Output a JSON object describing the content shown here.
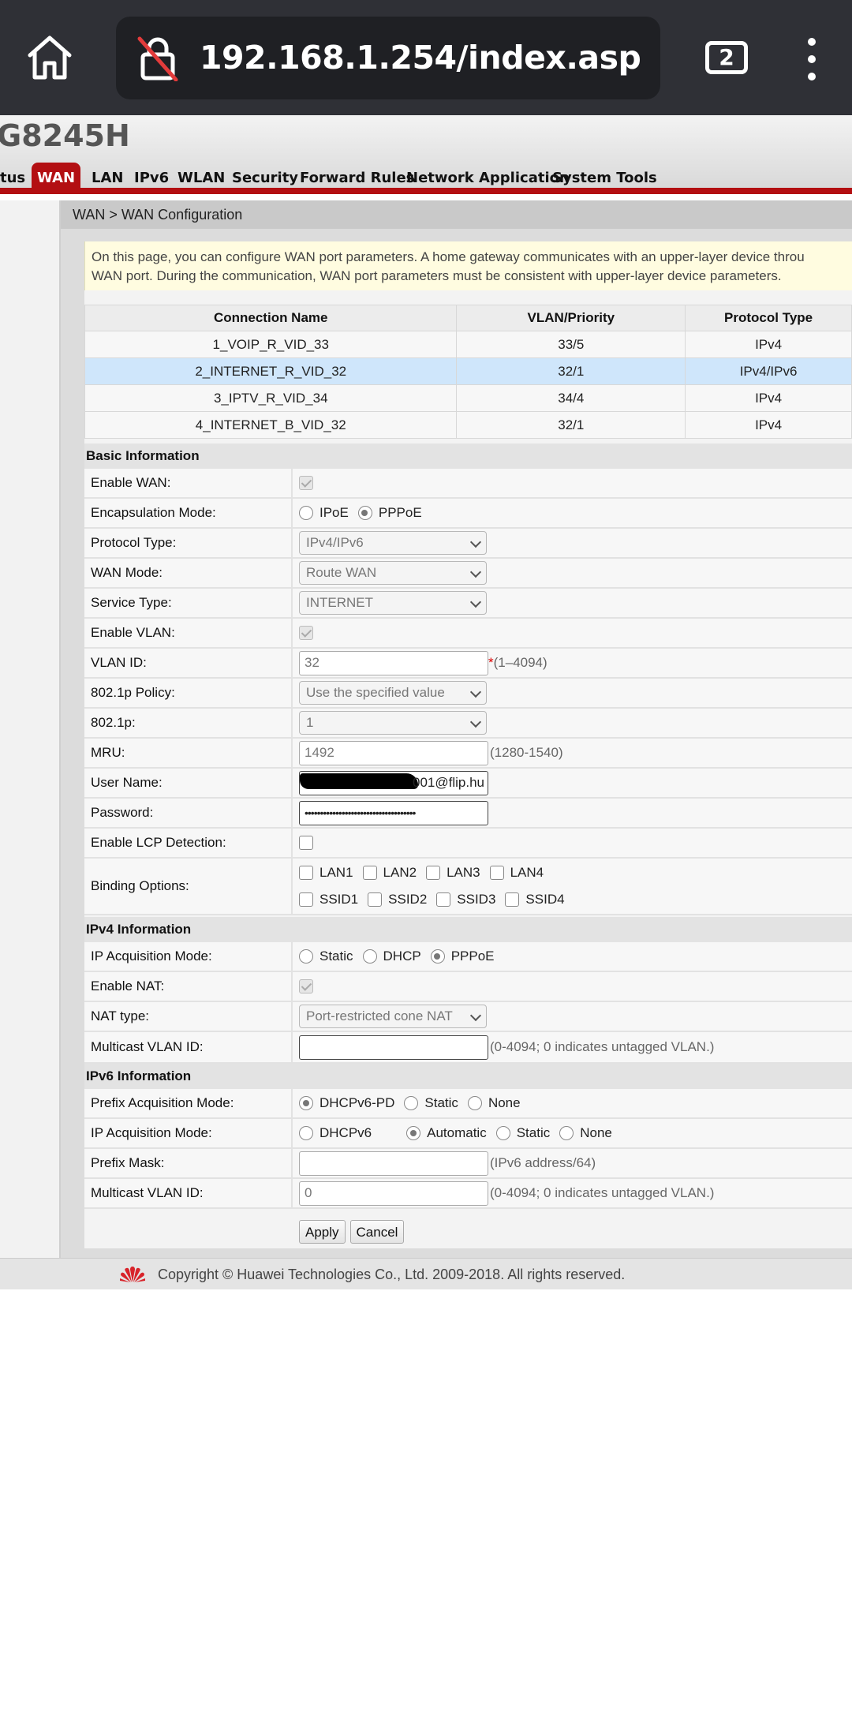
{
  "browser": {
    "url": "192.168.1.254/index.asp",
    "tab_count": "2"
  },
  "router": {
    "brand": "G8245H",
    "nav": [
      "tus",
      "WAN",
      "LAN",
      "IPv6",
      "WLAN",
      "Security",
      "Forward Rules",
      "Network Application",
      "System Tools"
    ],
    "active_nav": "WAN",
    "breadcrumb": "WAN > WAN Configuration",
    "notice_line1": "On this page, you can configure WAN port parameters. A home gateway communicates with an upper-layer device throu",
    "notice_line2": "WAN port. During the communication, WAN port parameters must be consistent with upper-layer device parameters."
  },
  "connections": {
    "headers": [
      "Connection Name",
      "VLAN/Priority",
      "Protocol Type"
    ],
    "rows": [
      [
        "1_VOIP_R_VID_33",
        "33/5",
        "IPv4"
      ],
      [
        "2_INTERNET_R_VID_32",
        "32/1",
        "IPv4/IPv6"
      ],
      [
        "3_IPTV_R_VID_34",
        "34/4",
        "IPv4"
      ],
      [
        "4_INTERNET_B_VID_32",
        "32/1",
        "IPv4"
      ]
    ],
    "selected_index": 1
  },
  "basic": {
    "title": "Basic Information",
    "enable_wan": "Enable WAN:",
    "encap": "Encapsulation Mode:",
    "encap_opt1": "IPoE",
    "encap_opt2": "PPPoE",
    "protocol": "Protocol Type:",
    "protocol_val": "IPv4/IPv6",
    "wan_mode": "WAN Mode:",
    "wan_mode_val": "Route WAN",
    "service": "Service Type:",
    "service_val": "INTERNET",
    "enable_vlan": "Enable VLAN:",
    "vlan_id": "VLAN ID:",
    "vlan_id_val": "32",
    "vlan_req": "*",
    "vlan_hint": "(1–4094)",
    "policy": "802.1p Policy:",
    "policy_val": "Use the specified value",
    "p8021": "802.1p:",
    "p8021_val": "1",
    "mru": "MRU:",
    "mru_val": "1492",
    "mru_hint": "(1280-1540)",
    "user": "User Name:",
    "user_val": "001@flip.hu",
    "password": "Password:",
    "password_val": "••••••••••••••••••••••••••••••••••••",
    "lcp": "Enable LCP Detection:",
    "binding": "Binding Options:",
    "bind_lan": [
      "LAN1",
      "LAN2",
      "LAN3",
      "LAN4"
    ],
    "bind_ssid": [
      "SSID1",
      "SSID2",
      "SSID3",
      "SSID4"
    ]
  },
  "ipv4": {
    "title": "IPv4 Information",
    "acq": "IP Acquisition Mode:",
    "acq_opts": [
      "Static",
      "DHCP",
      "PPPoE"
    ],
    "nat": "Enable NAT:",
    "nat_type": "NAT type:",
    "nat_type_val": "Port-restricted cone NAT",
    "mvlan": "Multicast VLAN ID:",
    "mvlan_val": "",
    "mvlan_hint": "(0-4094; 0 indicates untagged VLAN.)"
  },
  "ipv6": {
    "title": "IPv6 Information",
    "prefix_acq": "Prefix Acquisition Mode:",
    "prefix_opts": [
      "DHCPv6-PD",
      "Static",
      "None"
    ],
    "ip_acq": "IP Acquisition Mode:",
    "ip_opts": [
      "DHCPv6",
      "Automatic",
      "Static",
      "None"
    ],
    "prefix_mask": "Prefix Mask:",
    "prefix_mask_val": "",
    "prefix_mask_hint": "(IPv6 address/64)",
    "mvlan": "Multicast VLAN ID:",
    "mvlan_val": "0",
    "mvlan_hint": "(0-4094; 0 indicates untagged VLAN.)"
  },
  "buttons": {
    "apply": "Apply",
    "cancel": "Cancel"
  },
  "footer": {
    "copyright": "Copyright © Huawei Technologies Co., Ltd. 2009-2018. All rights reserved."
  },
  "colors": {
    "accent": "#b30f12",
    "selected_row": "#cfe6fb",
    "notice_bg": "#fffce0"
  }
}
